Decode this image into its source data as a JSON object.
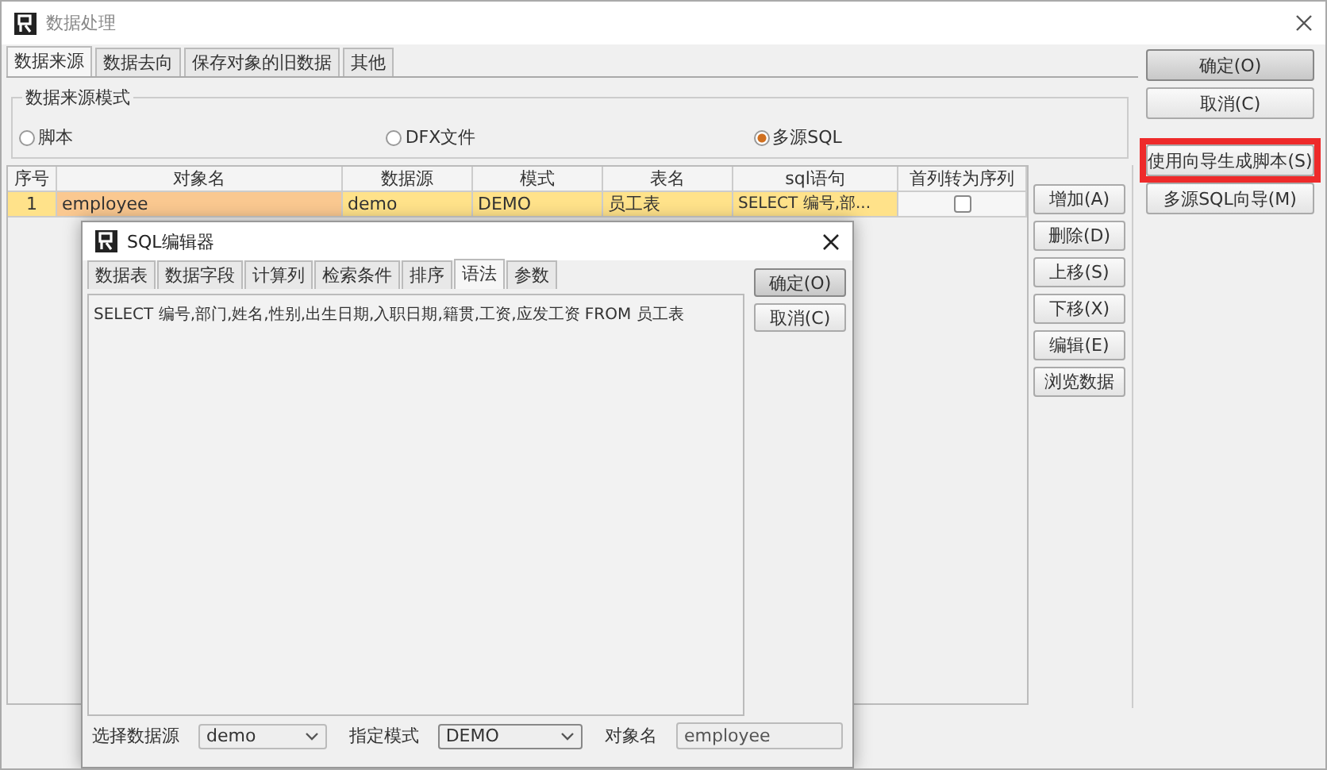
{
  "window": {
    "title": "数据处理"
  },
  "tabs": [
    {
      "label": "数据来源",
      "selected": true
    },
    {
      "label": "数据去向",
      "selected": false
    },
    {
      "label": "保存对象的旧数据",
      "selected": false
    },
    {
      "label": "其他",
      "selected": false
    }
  ],
  "source_mode": {
    "legend": "数据来源模式",
    "options": [
      {
        "label": "脚本",
        "selected": false
      },
      {
        "label": "DFX文件",
        "selected": false
      },
      {
        "label": "多源SQL",
        "selected": true
      }
    ]
  },
  "table": {
    "columns": [
      "序号",
      "对象名",
      "数据源",
      "模式",
      "表名",
      "sql语句",
      "首列转为序列"
    ],
    "rows": [
      {
        "cells": [
          "1",
          "employee",
          "demo",
          "DEMO",
          "员工表",
          "SELECT 编号,部..."
        ],
        "checked": false,
        "selected": true
      }
    ]
  },
  "row_buttons": [
    "增加(A)",
    "删除(D)",
    "上移(S)",
    "下移(X)",
    "编辑(E)",
    "浏览数据"
  ],
  "side_buttons": [
    {
      "label": "确定(O)",
      "default": true,
      "highlighted": false
    },
    {
      "label": "取消(C)",
      "default": false,
      "highlighted": false
    },
    {
      "label": "使用向导生成脚本(S)",
      "default": false,
      "highlighted": true
    },
    {
      "label": "多源SQL向导(M)",
      "default": false,
      "highlighted": false
    }
  ],
  "dialog": {
    "title": "SQL编辑器",
    "tabs": [
      {
        "label": "数据表",
        "selected": false
      },
      {
        "label": "数据字段",
        "selected": false
      },
      {
        "label": "计算列",
        "selected": false
      },
      {
        "label": "检索条件",
        "selected": false
      },
      {
        "label": "排序",
        "selected": false
      },
      {
        "label": "语法",
        "selected": true
      },
      {
        "label": "参数",
        "selected": false
      }
    ],
    "sql": "SELECT 编号,部门,姓名,性别,出生日期,入职日期,籍贯,工资,应发工资 FROM 员工表",
    "buttons": [
      {
        "label": "确定(O)",
        "default": true
      },
      {
        "label": "取消(C)",
        "default": false
      }
    ],
    "data_source": {
      "label": "选择数据源",
      "value": "demo"
    },
    "schema": {
      "label": "指定模式",
      "value": "DEMO"
    },
    "object_name": {
      "label": "对象名",
      "value": "employee"
    }
  }
}
